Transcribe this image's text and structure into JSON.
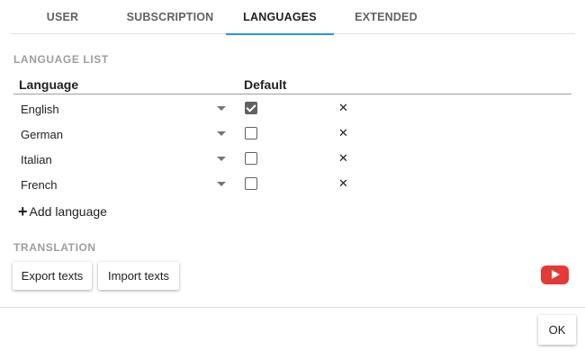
{
  "tabs": [
    {
      "label": "USER",
      "active": false
    },
    {
      "label": "SUBSCRIPTION",
      "active": false
    },
    {
      "label": "LANGUAGES",
      "active": true
    },
    {
      "label": "EXTENDED",
      "active": false
    }
  ],
  "language_list": {
    "section_title": "LANGUAGE LIST",
    "columns": {
      "language": "Language",
      "default": "Default"
    },
    "rows": [
      {
        "language": "English",
        "default": true
      },
      {
        "language": "German",
        "default": false
      },
      {
        "language": "Italian",
        "default": false
      },
      {
        "language": "French",
        "default": false
      }
    ],
    "remove_glyph": "✕",
    "add_label": "Add language",
    "add_glyph": "+"
  },
  "translation": {
    "section_title": "TRANSLATION",
    "export_label": "Export texts",
    "import_label": "Import texts",
    "video_icon": "youtube-play-icon"
  },
  "footer": {
    "ok_label": "OK"
  },
  "colors": {
    "accent": "#2196f3",
    "youtube": "#e53935"
  }
}
